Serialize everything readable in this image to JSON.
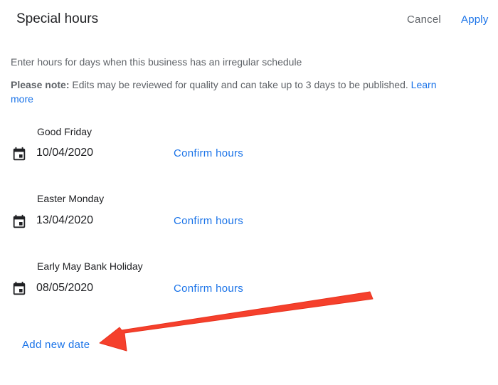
{
  "header": {
    "title": "Special hours",
    "cancel_label": "Cancel",
    "apply_label": "Apply"
  },
  "intro_text": "Enter hours for days when this business has an irregular schedule",
  "note": {
    "label": "Please note:",
    "text": " Edits may be reviewed for quality and can take up to 3 days to be published. ",
    "link": "Learn more"
  },
  "entries": [
    {
      "name": "Good Friday",
      "date": "10/04/2020",
      "action": "Confirm hours",
      "icon": "calendar-icon"
    },
    {
      "name": "Easter Monday",
      "date": "13/04/2020",
      "action": "Confirm hours",
      "icon": "calendar-icon"
    },
    {
      "name": "Early May Bank Holiday",
      "date": "08/05/2020",
      "action": "Confirm hours",
      "icon": "calendar-icon"
    }
  ],
  "add_new_date_label": "Add new date",
  "colors": {
    "accent": "#1a73e8",
    "annotation_arrow": "#f5402c",
    "secondary_text": "#5f6368"
  }
}
